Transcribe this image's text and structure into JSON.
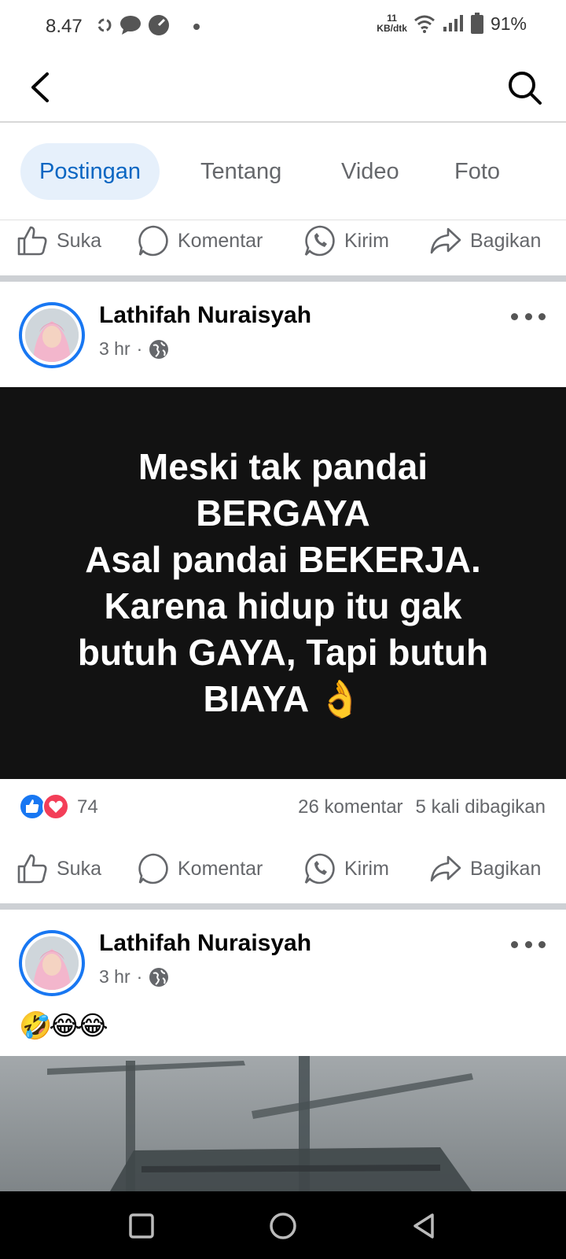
{
  "status_bar": {
    "time": "8.47",
    "net_speed_value": "11",
    "net_speed_unit": "KB/dtk",
    "battery": "91%"
  },
  "tabs": [
    {
      "label": "Postingan",
      "active": true
    },
    {
      "label": "Tentang",
      "active": false
    },
    {
      "label": "Video",
      "active": false
    },
    {
      "label": "Foto",
      "active": false
    }
  ],
  "actions": {
    "like": "Suka",
    "comment": "Komentar",
    "send": "Kirim",
    "share": "Bagikan"
  },
  "posts": [
    {
      "author": "Lathifah Nuraisyah",
      "time": "3 hr",
      "privacy_icon": "globe-icon",
      "text": "Meski tak pandai\nBERGAYA\nAsal pandai BEKERJA.\nKarena hidup itu gak\nbutuh GAYA, Tapi butuh\nBIAYA 👌",
      "reactions_count": "74",
      "comments": "26 komentar",
      "shares": "5 kali dibagikan"
    },
    {
      "author": "Lathifah Nuraisyah",
      "time": "3 hr",
      "privacy_icon": "globe-icon",
      "text": "🤣😂😂"
    }
  ],
  "colors": {
    "accent": "#0a66c2",
    "like_blue": "#1877f2",
    "love_red": "#f33e58",
    "text_post_bg": "#121212"
  }
}
